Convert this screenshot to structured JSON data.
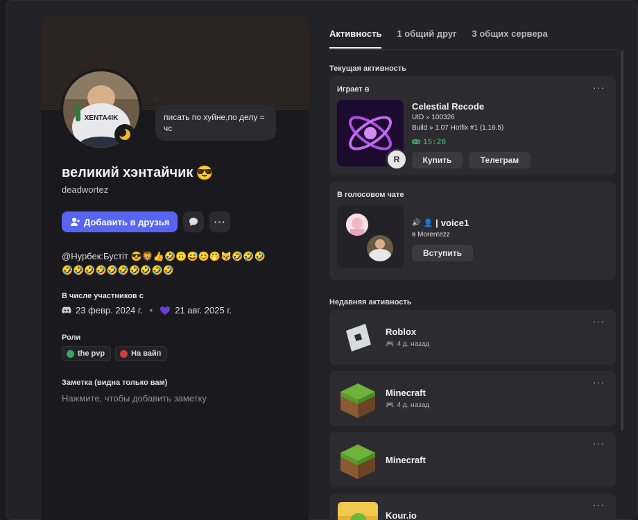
{
  "tabs": [
    {
      "label": "Активность",
      "active": true
    },
    {
      "label": "1 общий друг",
      "active": false
    },
    {
      "label": "3 общих сервера",
      "active": false
    }
  ],
  "profile": {
    "status_text": "писать по хуйне,по делу = чс",
    "display_name": "великий хэнтайчик",
    "display_emoji": "😎",
    "username": "deadwortez",
    "add_friend_label": "Добавить в друзья",
    "bio_line1": "@Нурбек:Бустiт 😎🦁👍🤣🙃😅😊🤭😼🤣🤣🤣",
    "bio_line2": "🤣🤣🤣🤣🤣🤣🤣🤣🤣🤣",
    "member_since_title": "В числе участников с",
    "discord_date": "23 февр. 2024 г.",
    "server_date": "21 авг. 2025 г.",
    "roles_title": "Роли",
    "roles": [
      {
        "name": "the pvp",
        "color": "#3ba55c"
      },
      {
        "name": "На вайп",
        "color": "#d83c3e"
      }
    ],
    "note_title": "Заметка (видна только вам)",
    "note_placeholder": "Нажмите, чтобы добавить заметку"
  },
  "current_activity": {
    "section_label": "Текущая активность",
    "playing_header": "Играет в",
    "game_title": "Celestial Recode",
    "uid_line": "UID » 100326",
    "build_line": "Build » 1.07 Hotfix #1 (1.16.5)",
    "elapsed": "15:20",
    "badge_text": "R",
    "buy_label": "Купить",
    "telegram_label": "Телеграм"
  },
  "voice": {
    "header": "В голосовом чате",
    "channel": "voice1",
    "server": "в Morentezz",
    "join_label": "Вступить"
  },
  "recent": {
    "section_label": "Недавняя активность",
    "items": [
      {
        "title": "Roblox",
        "sub": "4 д. назад"
      },
      {
        "title": "Minecraft",
        "sub": "4 д. назад"
      },
      {
        "title": "Minecraft",
        "sub": ""
      },
      {
        "title": "Kour.io",
        "sub": ""
      }
    ]
  },
  "colors": {
    "accent": "#5865f2",
    "online_green": "#3ba55c",
    "card_bg": "#2b2b30"
  }
}
